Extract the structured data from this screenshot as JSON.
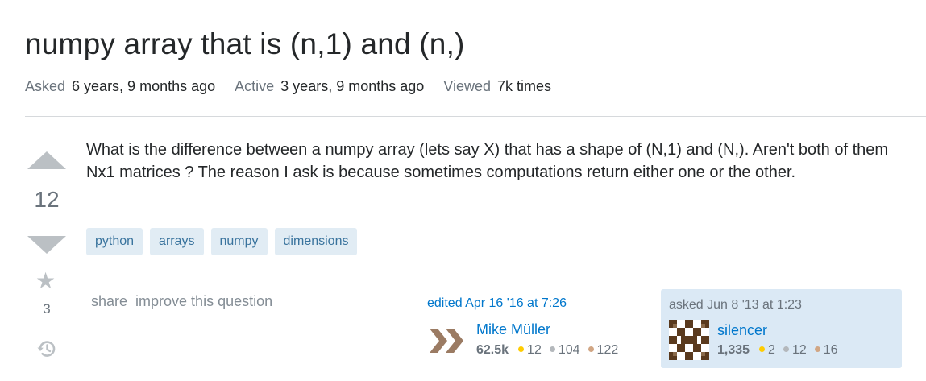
{
  "question": {
    "title": "numpy array that is (n,1) and (n,)",
    "meta": {
      "asked_label": "Asked",
      "asked_value": "6 years, 9 months ago",
      "active_label": "Active",
      "active_value": "3 years, 9 months ago",
      "viewed_label": "Viewed",
      "viewed_value": "7k times"
    },
    "votes": "12",
    "favorites": "3",
    "body": "What is the difference between a numpy array (lets say X) that has a shape of (N,1) and (N,). Aren't both of them Nx1 matrices ? The reason I ask is because sometimes computations return either one or the other.",
    "tags": [
      "python",
      "arrays",
      "numpy",
      "dimensions"
    ],
    "menu": {
      "share": "share",
      "improve": "improve this question"
    }
  },
  "editor": {
    "action": "edited Apr 16 '16 at 7:26",
    "name": "Mike Müller",
    "reputation": "62.5k",
    "gold": "12",
    "silver": "104",
    "bronze": "122",
    "avatar_icon": "double-chevron-avatar"
  },
  "owner": {
    "action": "asked Jun 8 '13 at 1:23",
    "name": "silencer",
    "reputation": "1,335",
    "gold": "2",
    "silver": "12",
    "bronze": "16",
    "avatar_icon": "identicon-avatar"
  },
  "colors": {
    "link": "#0077cc",
    "tag_bg": "#e1ecf4",
    "tag_text": "#39739d",
    "owner_bg": "#dbe9f5",
    "gold": "#ffcc01",
    "silver": "#b4b8bc",
    "bronze": "#d1a684"
  }
}
